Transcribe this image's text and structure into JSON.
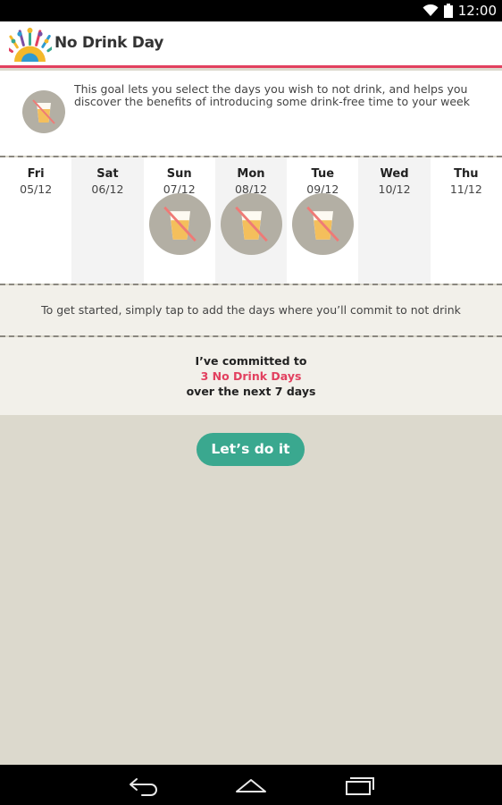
{
  "status_bar": {
    "time": "12:00",
    "icons": [
      "wifi-icon",
      "battery-icon"
    ]
  },
  "app": {
    "title": "No Drink Day",
    "accent": "#e2405f"
  },
  "goal": {
    "icon": "no-drink-icon",
    "text": "This goal lets you select the days you wish to not drink, and helps you discover the benefits of introducing some drink-free time to your week"
  },
  "days": [
    {
      "name": "Fri",
      "date": "05/12",
      "selected": false
    },
    {
      "name": "Sat",
      "date": "06/12",
      "selected": false
    },
    {
      "name": "Sun",
      "date": "07/12",
      "selected": true
    },
    {
      "name": "Mon",
      "date": "08/12",
      "selected": true
    },
    {
      "name": "Tue",
      "date": "09/12",
      "selected": true
    },
    {
      "name": "Wed",
      "date": "10/12",
      "selected": false
    },
    {
      "name": "Thu",
      "date": "11/12",
      "selected": false
    }
  ],
  "hint": "To get started, simply tap to add the days where you’ll commit to not drink",
  "commitment": {
    "line1": "I’ve committed to",
    "line2": "3 No Drink Days",
    "line3": "over the next 7 days"
  },
  "cta_label": "Let’s do it",
  "cta_color": "#3aa88f",
  "nav_bar": [
    "back-icon",
    "home-icon",
    "recent-apps-icon"
  ]
}
